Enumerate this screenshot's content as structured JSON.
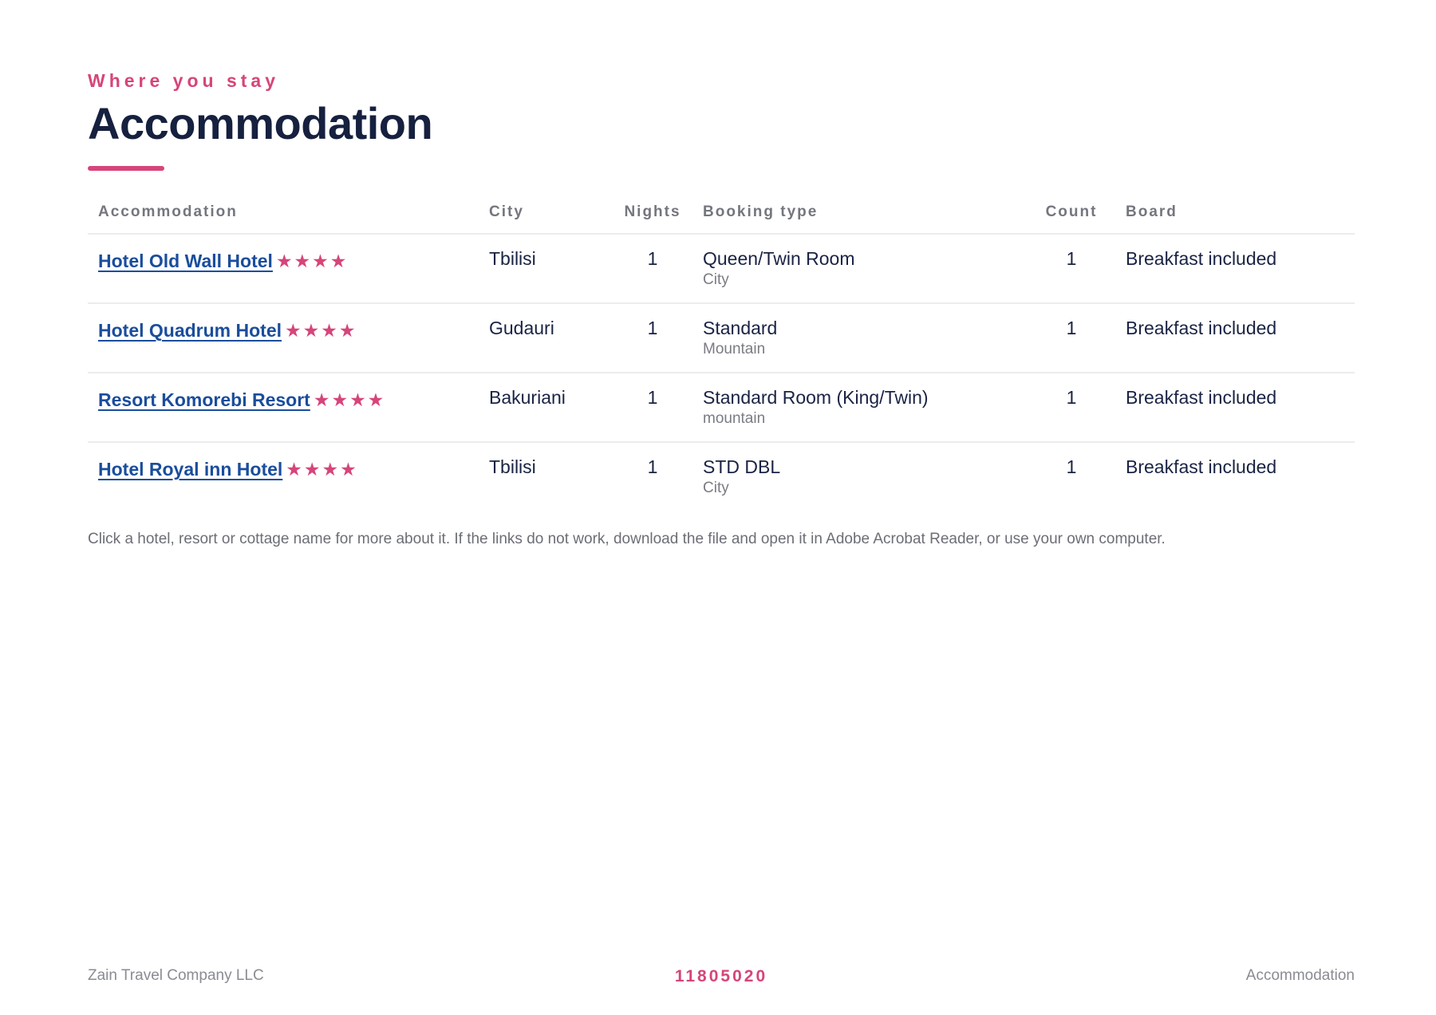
{
  "header": {
    "eyebrow": "Where you stay",
    "title": "Accommodation"
  },
  "table": {
    "columns": [
      "Accommodation",
      "City",
      "Nights",
      "Booking type",
      "Count",
      "Board"
    ],
    "rows": [
      {
        "name": "Hotel Old Wall Hotel",
        "stars": "★★★★",
        "rating": 4,
        "city": "Tbilisi",
        "nights": "1",
        "booking_type": "Queen/Twin Room",
        "booking_sub": "City",
        "count": "1",
        "board": "Breakfast included"
      },
      {
        "name": "Hotel Quadrum Hotel",
        "stars": "★★★★",
        "rating": 4,
        "city": "Gudauri",
        "nights": "1",
        "booking_type": "Standard",
        "booking_sub": "Mountain",
        "count": "1",
        "board": "Breakfast included"
      },
      {
        "name": "Resort Komorebi Resort",
        "stars": "★★★★",
        "rating": 4,
        "city": "Bakuriani",
        "nights": "1",
        "booking_type": "Standard Room (King/Twin)",
        "booking_sub": "mountain",
        "count": "1",
        "board": "Breakfast included"
      },
      {
        "name": "Hotel Royal inn Hotel",
        "stars": "★★★★",
        "rating": 4,
        "city": "Tbilisi",
        "nights": "1",
        "booking_type": "STD DBL",
        "booking_sub": "City",
        "count": "1",
        "board": "Breakfast included"
      }
    ]
  },
  "note": "Click a hotel, resort or cottage name for more about it. If the links do not work, download the file and open it in Adobe Acrobat Reader, or use your own computer.",
  "footer": {
    "company": "Zain Travel Company LLC",
    "reference": "11805020",
    "section": "Accommodation"
  },
  "colors": {
    "accent": "#d6457a",
    "title": "#16203f",
    "link": "#1a4d9c",
    "muted": "#74767e"
  }
}
